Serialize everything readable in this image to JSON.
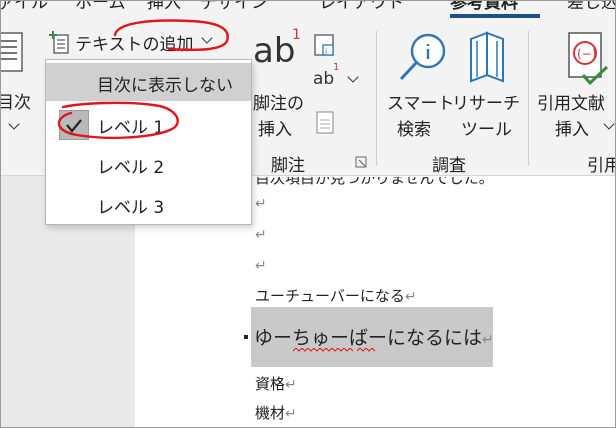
{
  "tabs": [
    {
      "label": "ァイル"
    },
    {
      "label": "ホーム"
    },
    {
      "label": "挿入"
    },
    {
      "label": "デザイン"
    },
    {
      "label": "レイアウト"
    },
    {
      "label": "参考資料"
    },
    {
      "label": "差し込"
    }
  ],
  "ribbon": {
    "toc_button": {
      "label": "目次"
    },
    "add_text_button": {
      "label": "テキストの追加"
    },
    "footnote_button": {
      "line1": "脚注の",
      "line2": "挿入",
      "icon_text": "ab",
      "superscript": "1"
    },
    "endnote_icon_text": "ab",
    "endnote_superscript": "1",
    "footnotes_group": {
      "label": "脚注"
    },
    "smart_lookup_button": {
      "line1": "スマート",
      "line2": "検索"
    },
    "researcher_button": {
      "line1": "リサーチ",
      "line2": "ツール"
    },
    "research_group": {
      "label": "調査"
    },
    "citation_button": {
      "line1": "引用文献",
      "line2": "挿入"
    },
    "citation_group": {
      "label": "引用"
    }
  },
  "dropdown": {
    "items": [
      {
        "label": "目次に表示しない"
      },
      {
        "label": "レベル 1",
        "checked": true
      },
      {
        "label": "レベル 2"
      },
      {
        "label": "レベル 3"
      }
    ]
  },
  "document": {
    "cut_line": "目次項目が見つかりませんでした。",
    "empty_mark": "↵",
    "line1": "ユーチューバーになる",
    "line2": "ゆーちゅーばーになるには",
    "line3": "資格",
    "line4": "機材"
  },
  "colors": {
    "annotation_red": "#e0161d",
    "tab_underline": "#1f4e8c",
    "icon_blue": "#2e75b6",
    "footnote_red": "#d13438"
  }
}
